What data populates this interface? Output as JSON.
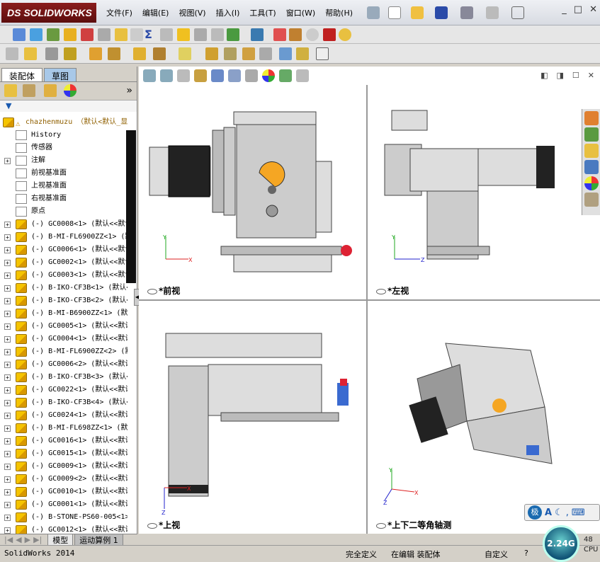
{
  "app": {
    "logo": "SOLIDWORKS",
    "brand_mark": "DS"
  },
  "menu": [
    "文件(F)",
    "编辑(E)",
    "视图(V)",
    "插入(I)",
    "工具(T)",
    "窗口(W)",
    "帮助(H)"
  ],
  "window_controls": [
    "_",
    "□",
    "✕"
  ],
  "panel": {
    "tabs": [
      "装配体",
      "草图"
    ],
    "root": "chazhenmuzu （默认<默认_显",
    "items": [
      {
        "label": "History",
        "icon": "history-icon"
      },
      {
        "label": "传感器",
        "icon": "sensor-icon"
      },
      {
        "label": "注解",
        "icon": "annotation-icon",
        "expandable": true
      },
      {
        "label": "前视基准面",
        "icon": "plane-icon"
      },
      {
        "label": "上视基准面",
        "icon": "plane-icon"
      },
      {
        "label": "右视基准面",
        "icon": "plane-icon"
      },
      {
        "label": "原点",
        "icon": "origin-icon"
      }
    ],
    "parts": [
      "(-) GC0008<1> (默认<<默认",
      "(-) B-MI-FL6900ZZ<1> (默认",
      "(-) GC0006<1> (默认<<默认",
      "(-) GC0002<1> (默认<<默认",
      "(-) GC0003<1> (默认<<默认",
      "(-) B-IKO-CF3B<1> (默认<<",
      "(-) B-IKO-CF3B<2> (默认<<",
      "(-) B-MI-B6900ZZ<1> (默认",
      "(-) GC0005<1> (默认<<默认",
      "(-) GC0004<1> (默认<<默认",
      "(-) B-MI-FL6900ZZ<2> (默认",
      "(-) GC0006<2> (默认<<默认",
      "(-) B-IKO-CF3B<3> (默认<<",
      "(-) GC0022<1> (默认<<默认",
      "(-) B-IKO-CF3B<4> (默认<<",
      "(-) GC0024<1> (默认<<默认",
      "(-) B-MI-FL698ZZ<1> (默认",
      "(-) GC0016<1> (默认<<默认",
      "(-) GC0015<1> (默认<<默认",
      "(-) GC0009<1> (默认<<默认",
      "(-) GC0009<2> (默认<<默认",
      "(-) GC0010<1> (默认<<默认",
      "(-) GC0001<1> (默认<<默认",
      "(-) B-STONE-PS60-005<1>",
      "(-) GC0012<1> (默认<<默认"
    ]
  },
  "viewports": {
    "front": "*前视",
    "left": "*左视",
    "top": "*上视",
    "iso": "*上下二等角轴测"
  },
  "triad": {
    "x": "X",
    "y": "Y",
    "z": "Z"
  },
  "bottom_tabs": [
    "模型",
    "运动算例 1"
  ],
  "status": {
    "app_version": "SolidWorks 2014",
    "definition": "完全定义",
    "editing": "在编辑 装配体",
    "units": "自定义",
    "help": "?"
  },
  "ime": {
    "glyph": "极",
    "a_label": "A"
  },
  "perf": {
    "gauge": "2.24G",
    "pct": "48",
    "cpu": "CPU"
  },
  "colors": {
    "accent": "#ffa500",
    "brand": "#7a1616",
    "selection": "#a8c8e8"
  }
}
